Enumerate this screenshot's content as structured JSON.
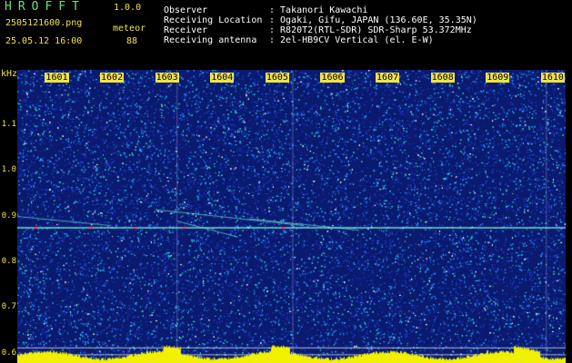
{
  "header": {
    "app_title": "HROFFT",
    "version": "1.0.0",
    "file_name": "2505121600.png",
    "datetime": "25.05.12 16:00",
    "meteor_label": "meteor",
    "meteor_count": "88",
    "fields": [
      {
        "label": "Observer",
        "value": ": Takanori Kawachi"
      },
      {
        "label": "Receiving Location",
        "value": ": Ogaki, Gifu, JAPAN (136.60E, 35.35N)"
      },
      {
        "label": "Receiver",
        "value": ": R820T2(RTL-SDR) SDR-Sharp 53.372MHz"
      },
      {
        "label": "Receiving antenna",
        "value": ": 2el-HB9CV Vertical (el. E-W)"
      }
    ]
  },
  "spectrogram": {
    "unit": "kHz",
    "y_ticks": [
      "1.1",
      "1.0",
      "0.9",
      "0.8",
      "0.7",
      "0.6"
    ],
    "y_range": [
      0.58,
      1.22
    ],
    "x_ticks": [
      "1601",
      "1602",
      "1603",
      "1604",
      "1605",
      "1606",
      "1607",
      "1608",
      "1609",
      "1610"
    ],
    "x_range": [
      1600.3,
      1610.25
    ],
    "colors": {
      "background": "#0a1a6e",
      "noise_dots": [
        "#1e3fd0",
        "#2aa0ff",
        "#36e0d0",
        "#ffffff"
      ],
      "level_bars": "#f0f000",
      "trace": "#80ffe0"
    },
    "carrier_khz": 0.875
  }
}
